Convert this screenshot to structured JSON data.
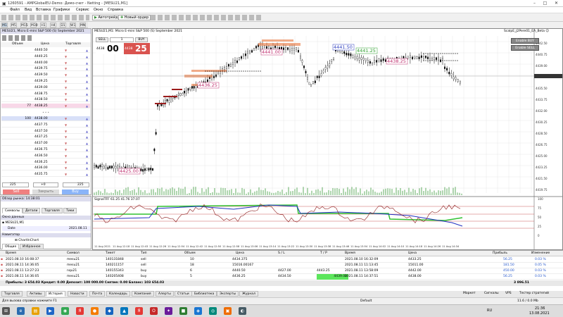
{
  "window": {
    "title": "1260591 - AMPGlobalEU-Demo: Демо-счет - Netting - [MESU21,M1]"
  },
  "menu": [
    "Файл",
    "Вид",
    "Вставка",
    "Графики",
    "Сервис",
    "Окно",
    "Справка"
  ],
  "toolbar": {
    "algo": "Автотрейдинг",
    "neworder": "Новый ордер"
  },
  "timeframes": [
    "M1",
    "M5",
    "M15",
    "M30",
    "H1",
    "H4",
    "D1",
    "W1",
    "MN"
  ],
  "dom": {
    "title": "MESU21, Micro E-mini S&P 500 (S) September 2021",
    "headers": {
      "volume": "Объем",
      "price": "Цена",
      "trade": "Торговля"
    },
    "ask_rows": [
      {
        "p": "4440.50"
      },
      {
        "p": "4440.25"
      },
      {
        "p": "4440.00"
      },
      {
        "p": "4439.75"
      },
      {
        "p": "4439.50"
      },
      {
        "p": "4439.25"
      },
      {
        "p": "4439.00"
      },
      {
        "p": "4438.75"
      },
      {
        "p": "4438.50"
      },
      {
        "v": "77",
        "p": "4438.25"
      }
    ],
    "spacer": "• • •",
    "bid_rows": [
      {
        "v": "100",
        "p": "4438.00"
      },
      {
        "p": "4437.75"
      },
      {
        "p": "4437.50"
      },
      {
        "p": "4437.25"
      },
      {
        "p": "4437.00"
      },
      {
        "p": "4436.75"
      },
      {
        "p": "4436.50"
      },
      {
        "p": "4436.25"
      },
      {
        "p": "4436.00"
      },
      {
        "p": "4435.75"
      }
    ],
    "controls": {
      "v1": "225",
      "v2": "+0",
      "v3": "225",
      "sell": "Sell",
      "close": "Закрыть",
      "buy": "Buy"
    }
  },
  "market_watch": {
    "title": "Обзор рынка: 14:38:01",
    "tabs": [
      "Символы",
      "Детали",
      "Торговля",
      "Тики"
    ],
    "group": "Окно данных",
    "symbol": "MESU21,M1",
    "data_label": "Date",
    "data_value": "2021.08.11",
    "nav_title": "Навигатор",
    "nav_item": "ChartInChart",
    "nav_tabs": [
      "Общие",
      "Избранное"
    ]
  },
  "chart": {
    "title": "MESU21,M1: Micro E-mini S&P 500 (S) September 2021",
    "ea_label": "ScalpE_J2Pere01_EA_Beta ☺",
    "sell_btn": "SELL",
    "buy_btn": "BUY",
    "lot": "1",
    "bid_big": "4438",
    "bid_small": "00",
    "ask_big": "4438",
    "ask_small": "25",
    "enable_buy": "Enable BUY",
    "enable_sell": "Enable SELL",
    "labels": [
      "4425.00",
      "4436.25",
      "4441.00",
      "4441.50",
      "4441.25",
      "4438.25"
    ],
    "price_axis": [
      "4442.50",
      "4440.75",
      "4439.00",
      "4437.25",
      "4435.50",
      "4433.75",
      "4432.00",
      "4430.25",
      "4428.50",
      "4426.75",
      "4425.00",
      "4423.25",
      "4421.50",
      "4419.75"
    ],
    "time_axis": [
      "11 Aug 2021",
      "11 Aug 12:18",
      "11 Aug 12:43",
      "11 Aug 12:26",
      "11 Aug 12:54",
      "11 Aug 12:42",
      "11 Aug 12:50",
      "11 Aug 12:58",
      "11 Aug 13:06",
      "11 Aug 13:14",
      "11 Aug 13:22",
      "11 Aug 13:30",
      "11 Aug 13:38",
      "11 Aug 13:46",
      "11 Aug 13:54",
      "11 Aug 14:02",
      "11 Aug 14:10",
      "11 Aug 14:18",
      "11 Aug 14:26",
      "11 Aug 14:34"
    ],
    "ind_label": "SignalTFF 61.25 41.76 37.07",
    "ind_axis": [
      "100",
      "75",
      "50",
      "25",
      "0"
    ]
  },
  "trades": {
    "headers": [
      "Время",
      "Символ",
      "Тикет",
      "Тип",
      "Объем",
      "Цена",
      "S / L",
      "T / P",
      "Время",
      "Цена",
      "Прибыль",
      "Изменение"
    ],
    "rows": [
      {
        "t": "2021.08.10 16:08:37",
        "s": "mesu21",
        "k": "140131848",
        "ty": "sell",
        "v": "10",
        "p": "4434.375",
        "sl": "",
        "tp": "",
        "t2": "2021.08.10 16:32:09",
        "p2": "4433.25",
        "pr": "56.25",
        "ch": "0.03 %"
      },
      {
        "t": "2021.08.11 14:36:05",
        "s": "mesu21",
        "k": "140211157",
        "ty": "sell",
        "v": "18",
        "p": "15016.00167",
        "sl": "",
        "tp": "",
        "t2": "2021.08.11 11:13:45",
        "p2": "15011.00",
        "pr": "181.50",
        "ch": "0.05 %"
      },
      {
        "t": "2021.08.11 13:27:23",
        "s": "nqu21",
        "k": "140155343",
        "ty": "buy",
        "v": "6",
        "p": "4440.50",
        "sl": "4427.00",
        "tp": "4443.25",
        "t2": "2021.08.11 13:58:09",
        "p2": "4442.00",
        "pr": "450.00",
        "ch": "0.03 %"
      },
      {
        "t": "2021.08.11 14:36:05",
        "s": "mesu21",
        "k": "140205408",
        "ty": "buy",
        "v": "5",
        "p": "4436.25",
        "sl": "4434.50",
        "tp": "4439.00",
        "t2": "2021.08.11 14:37:51",
        "p2": "4438.00",
        "pr": "56.25",
        "ch": "0.03 %"
      }
    ],
    "summary": "Прибыль: 3 654.03  Кредит: 0.00  Депозит: 100 000.00  Снятие: 0.00  Баланс: 103 654.03",
    "total": "3 896.51"
  },
  "bottom_tabs": [
    "Торговля",
    "Активы",
    "История",
    "Новости",
    "Почта",
    "Календарь",
    "Компания",
    "Алерты",
    "Статьи",
    "Библиотека",
    "Эксперты",
    "Журнал"
  ],
  "bottom_right": [
    "Маркет",
    "Сигналы",
    "VPS",
    "Тестер стратегий"
  ],
  "status": {
    "left": "Для вызова справки нажмите F1",
    "mid": "Default",
    "right": "11.6 / 0.0 Mb"
  },
  "clock": {
    "time": "21:36",
    "date": "13.08.2021",
    "lang": "RU"
  }
}
